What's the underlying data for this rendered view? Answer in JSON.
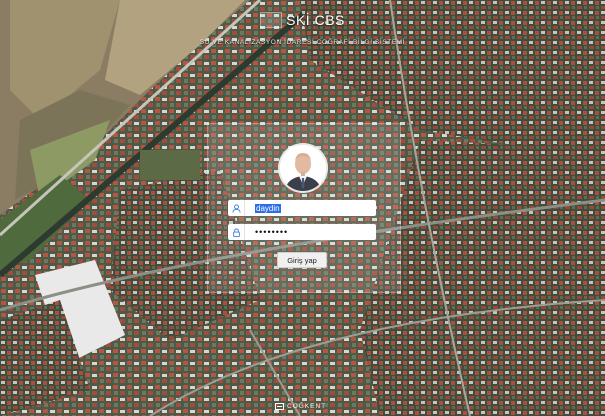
{
  "brand": {
    "title": "SKİ CBS",
    "subtitle": "SU VE KANALİZASYON İDARESİ COĞRAFİ BİLGİ SİSTEMİ"
  },
  "login": {
    "username_value": "daydin",
    "password_value": "••••••••",
    "submit_label": "Giriş yap"
  },
  "footer": {
    "vendor": "COĞKENT"
  },
  "colors": {
    "selection": "#2b6ee8",
    "field_icon": "#3c7bd9"
  }
}
